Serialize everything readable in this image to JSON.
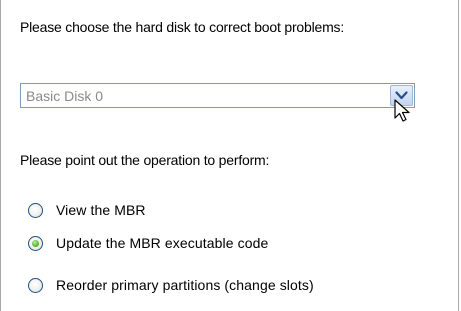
{
  "disk_prompt": "Please choose the hard disk to correct boot problems:",
  "disk_select": {
    "value": "Basic Disk 0"
  },
  "operation_prompt": "Please point out the operation to perform:",
  "operations": [
    {
      "label": "View the MBR",
      "checked": false
    },
    {
      "label": "Update the MBR executable code",
      "checked": true
    },
    {
      "label": "Reorder primary partitions (change slots)",
      "checked": false
    }
  ],
  "icons": {
    "dropdown": "chevron-down-icon",
    "cursor": "mouse-pointer-icon"
  }
}
